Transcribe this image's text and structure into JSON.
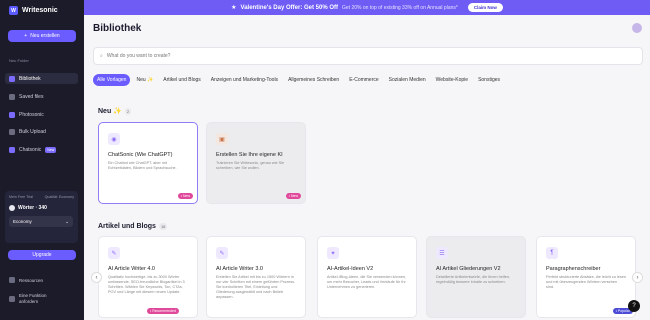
{
  "sidebar": {
    "logo": "Writesonic",
    "new_button": "Neu erstellen",
    "section_label": "Neu Folder",
    "items": [
      {
        "label": "Bibliothek"
      },
      {
        "label": "Saved files"
      },
      {
        "label": "Photosonic"
      },
      {
        "label": "Bulk Upload"
      },
      {
        "label": "Chatsonic",
        "badge": "New"
      }
    ],
    "plan": {
      "left": "Mein Free Trial",
      "right": "Qualität: Economy",
      "words": "Wörter · 340",
      "select": "Economy"
    },
    "upgrade": "Upgrade",
    "bottom": [
      "Ressourcen",
      "Eine Funktion anfordern"
    ]
  },
  "banner": {
    "text": "Valentine's Day Offer: Get 50% Off",
    "sub": "Get 20% on top of existing 33% off on Annual plans*",
    "button": "Claim Now"
  },
  "main": {
    "title": "Bibliothek",
    "search_placeholder": "What do you want to create?",
    "tabs": [
      "Alle Vorlagen",
      "Neu ✨",
      "Artikel und Blogs",
      "Anzeigen und Marketing-Tools",
      "Allgemeines Schreiben",
      "E-Commerce",
      "Sozialen Medien",
      "Website-Kopie",
      "Sonstiges"
    ],
    "section_new": {
      "title": "Neu ✨",
      "count": "2"
    },
    "new_cards": [
      {
        "title": "ChatSonic (Wie ChatGPT)",
        "desc": "Ein Chatbot wie ChatGPT, aber mit Echtzeitdaten, Bildern und Sprachsuche.",
        "pill": "• New"
      },
      {
        "title": "Erstellen Sie Ihre eigene KI",
        "desc": "Trainieren Sie Writesonic, genau wie Sie schreiben, wie Sie wollen.",
        "pill": "• New"
      }
    ],
    "section_articles": {
      "title": "Artikel und Blogs",
      "count": "18"
    },
    "article_cards": [
      {
        "title": "AI Article Writer 4.0",
        "desc": "Qualitativ hochwertige, bis zu 3000 Wörter umfassende, SEO-freundliche Blogartikel in 3 Schritten. Wählen Sie Keywords, Ton, CTAs, POV und Länge mit diesem neuen Update.",
        "pill": "• Recommended"
      },
      {
        "title": "AI Article Writer 3.0",
        "desc": "Erstellen Sie Artikel mit bis zu 1500 Wörtern in nur vier Schritten mit einem geführten Prozess. Sie kontrollieren Titel, Einleitung und Gliederung ausgewählt und nach Belieb anpassen.",
        "pill": ""
      },
      {
        "title": "AI-Artikel-Ideen V2",
        "desc": "Artikel-/Blog-Ideen, die Sie verwenden können, um mehr Besucher, Leads und Verkäufe für Ihr Unternehmen zu generieren.",
        "pill": ""
      },
      {
        "title": "AI Artikel Gliederungen V2",
        "desc": "Detaillierte Artikelentwürfe, die Ihnen helfen, regelmäßig bessere Inhalte zu schreiben.",
        "pill": ""
      },
      {
        "title": "Paragraphenschreiber",
        "desc": "Perfekt strukturierte Absätze, die leicht zu lesen und mit überzeugenden Wörtern versehen sind.",
        "pill": "• Popular"
      }
    ]
  }
}
